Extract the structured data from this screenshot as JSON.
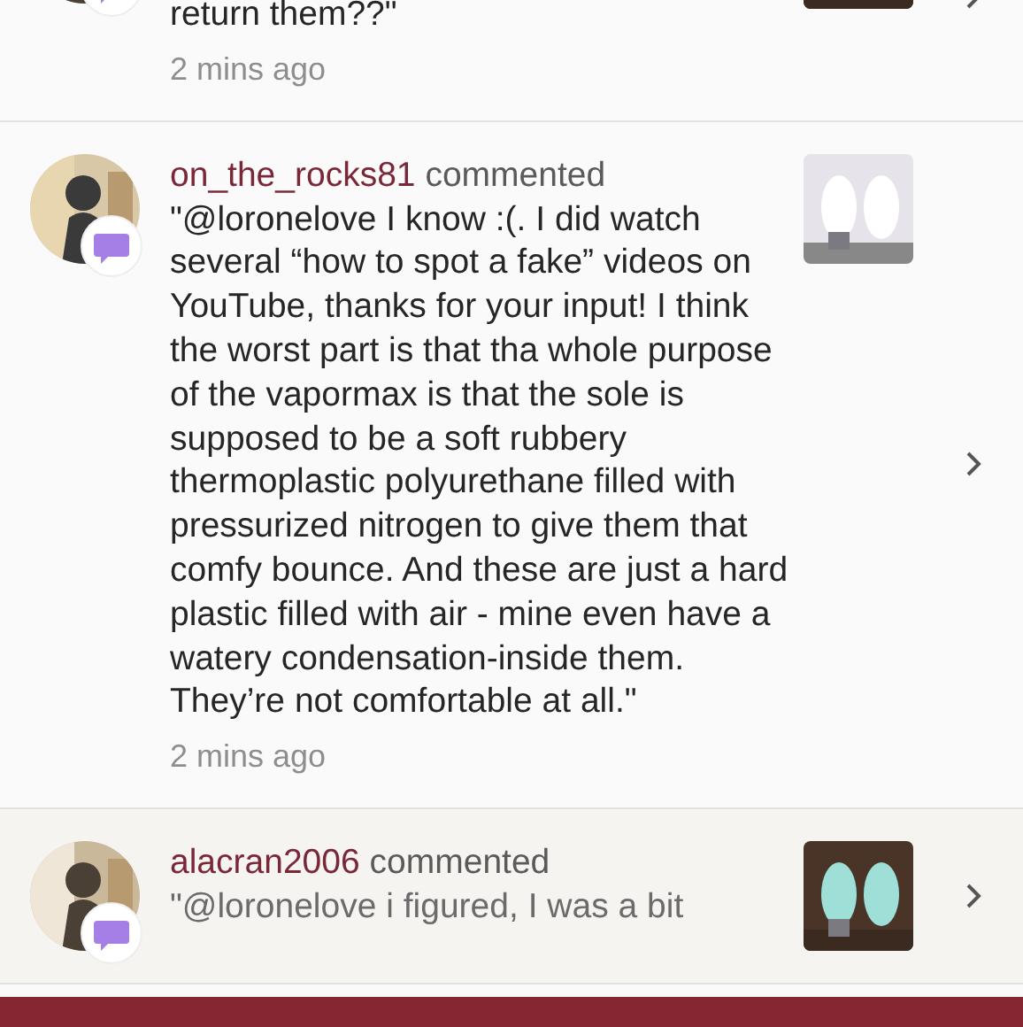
{
  "notifications": [
    {
      "kind": "partial",
      "highlighted": false,
      "comment": "return them??\"",
      "time": "2 mins ago"
    },
    {
      "kind": "full",
      "highlighted": false,
      "user": "on_the_rocks81",
      "action": "commented",
      "comment": "\"@loronelove I know :(. I did watch several “how to spot a fake” videos on YouTube, thanks for your input! I think the worst part is that tha whole purpose of the vapormax is that the sole is supposed to be a soft rubbery thermoplastic polyurethane filled with pressurized nitrogen to give them that comfy bounce. And these are just a hard plastic filled with air - mine even have a watery condensation-inside them. They’re not comfortable at all.\"",
      "time": "2 mins ago"
    },
    {
      "kind": "full",
      "highlighted": true,
      "user": "alacran2006",
      "action": "commented",
      "comment": "\"@loronelove i figured, I was a bit"
    }
  ]
}
